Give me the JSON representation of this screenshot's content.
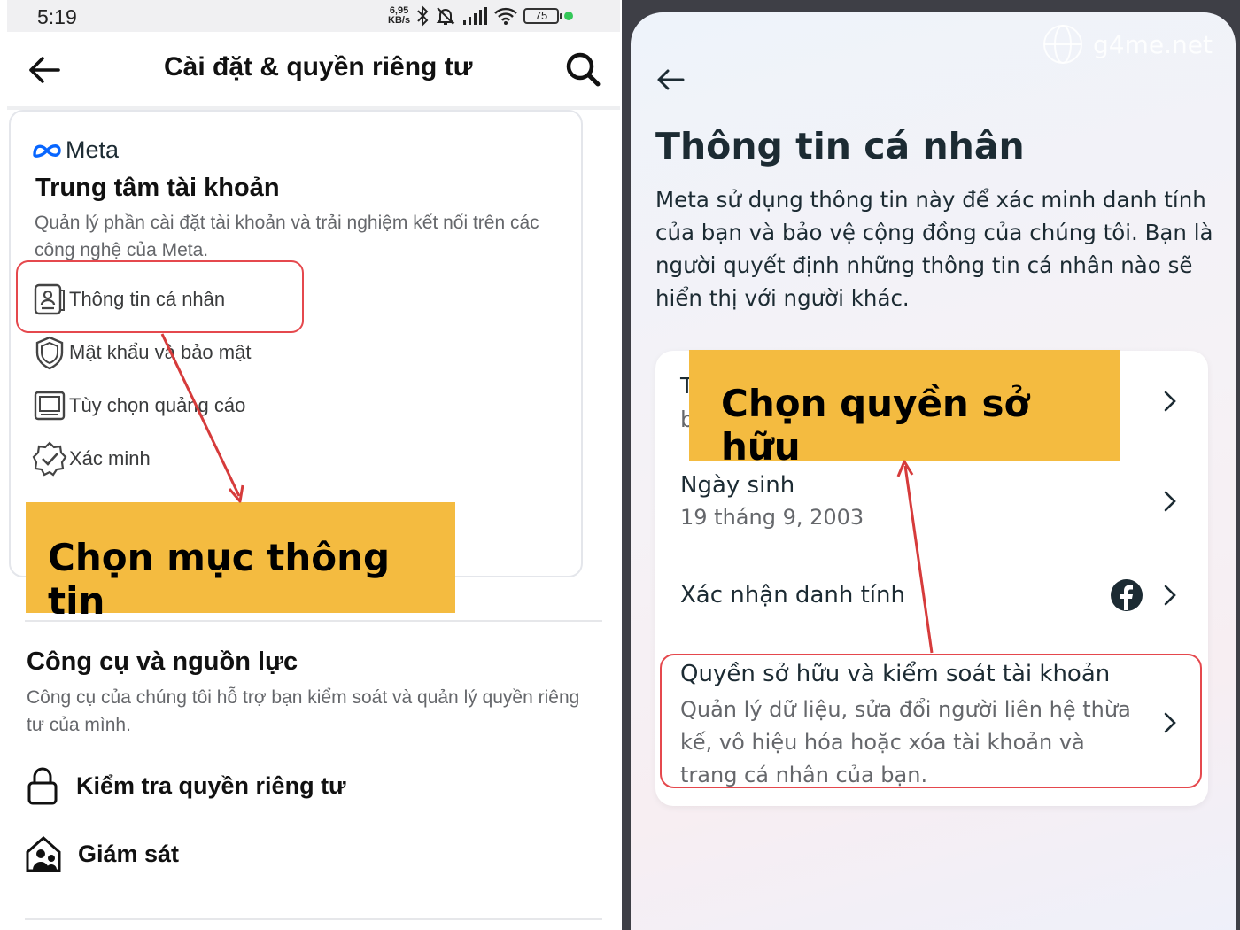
{
  "left_screen": {
    "status_bar": {
      "time": "5:19",
      "net_speed_value": "6,95",
      "net_speed_unit": "KB/s",
      "battery": "75"
    },
    "header": {
      "title": "Cài đặt & quyền riêng tư"
    },
    "accounts_center": {
      "brand": "Meta",
      "title": "Trung tâm tài khoản",
      "description": "Quản lý phần cài đặt tài khoản và trải nghiệm kết nối trên các công nghệ của Meta.",
      "items": [
        {
          "label": "Thông tin cá nhân",
          "icon": "id-card-icon"
        },
        {
          "label": "Mật khẩu và bảo mật",
          "icon": "shield-icon"
        },
        {
          "label": "Tùy chọn quảng cáo",
          "icon": "monitor-icon"
        },
        {
          "label": "Xác minh",
          "icon": "verified-badge-icon"
        }
      ]
    },
    "tools": {
      "title": "Công cụ và nguồn lực",
      "description": "Công cụ của chúng tôi hỗ trợ bạn kiểm soát và quản lý quyền riêng tư của mình.",
      "items": [
        {
          "label": "Kiểm tra quyền riêng tư",
          "icon": "lock-icon"
        },
        {
          "label": "Giám sát",
          "icon": "family-home-icon"
        }
      ]
    },
    "annotation": "Chọn mục thông tin"
  },
  "right_screen": {
    "watermark": "g4me.net",
    "title": "Thông tin cá nhân",
    "description": "Meta sử dụng thông tin này để xác minh danh tính của bạn và bảo vệ cộng đồng của chúng tôi. Bạn là người quyết định những thông tin cá nhân nào sẽ hiển thị với người khác.",
    "partial_row": {
      "line1": "T",
      "line2": "b"
    },
    "rows": {
      "birthday_label": "Ngày sinh",
      "birthday_value": "19 tháng 9, 2003",
      "identity_label": "Xác nhận danh tính",
      "ownership_label": "Quyền sở hữu và kiểm soát tài khoản",
      "ownership_desc": "Quản lý dữ liệu, sửa đổi người liên hệ thừa kế, vô hiệu hóa hoặc xóa tài khoản và trang cá nhân của bạn."
    },
    "annotation": "Chọn quyền sở hữu"
  },
  "colors": {
    "callout": "#f4bb40",
    "highlight": "#e5484d",
    "facebook_blue": "#1c2b33"
  }
}
